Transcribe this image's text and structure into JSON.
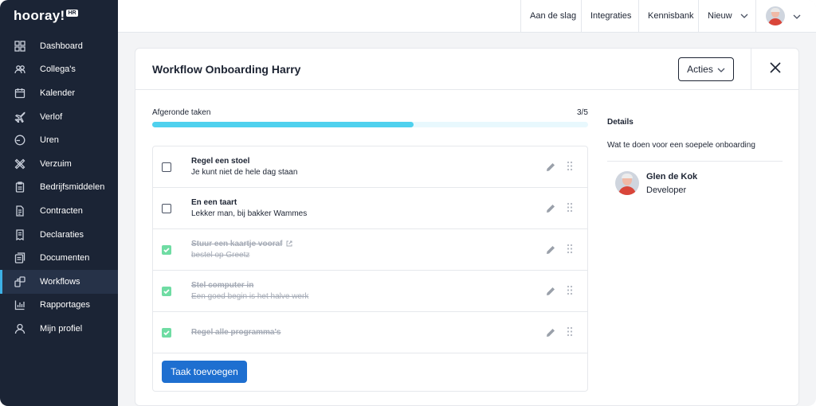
{
  "app": {
    "logo_text": "hooray!",
    "logo_badge": "HR"
  },
  "sidebar": {
    "items": [
      {
        "label": "Dashboard",
        "icon": "dashboard-icon"
      },
      {
        "label": "Collega's",
        "icon": "colleagues-icon"
      },
      {
        "label": "Kalender",
        "icon": "calendar-icon"
      },
      {
        "label": "Verlof",
        "icon": "plane-icon"
      },
      {
        "label": "Uren",
        "icon": "clock-icon"
      },
      {
        "label": "Verzuim",
        "icon": "bandage-icon"
      },
      {
        "label": "Bedrijfsmiddelen",
        "icon": "clipboard-icon"
      },
      {
        "label": "Contracten",
        "icon": "contract-icon"
      },
      {
        "label": "Declaraties",
        "icon": "receipt-icon"
      },
      {
        "label": "Documenten",
        "icon": "documents-icon"
      },
      {
        "label": "Workflows",
        "icon": "workflow-icon",
        "active": true
      },
      {
        "label": "Rapportages",
        "icon": "chart-icon"
      },
      {
        "label": "Mijn profiel",
        "icon": "user-icon"
      }
    ]
  },
  "topbar": {
    "items": [
      "Aan de slag",
      "Integraties",
      "Kennisbank",
      "Nieuw"
    ]
  },
  "panel": {
    "title": "Workflow Onboarding Harry",
    "actions_label": "Acties",
    "progress_label": "Afgeronde taken",
    "progress_count": "3/5",
    "progress_fraction": 0.6,
    "tasks": [
      {
        "title": "Regel een stoel",
        "sub": "Je kunt niet de hele dag staan",
        "done": false
      },
      {
        "title": "En een taart",
        "sub": "Lekker man, bij bakker Wammes",
        "done": false
      },
      {
        "title": "Stuur een kaartje vooraf",
        "sub": "bestel op Greetz",
        "done": true,
        "external": true
      },
      {
        "title": "Stel computer in",
        "sub": "Een goed begin is het halve werk",
        "done": true
      },
      {
        "title": "Regel alle programma's",
        "sub": "",
        "done": true
      }
    ],
    "add_task_label": "Taak toevoegen"
  },
  "details": {
    "title": "Details",
    "description": "Wat te doen voor een soepele onboarding",
    "person_name": "Glen de Kok",
    "person_role": "Developer"
  },
  "colors": {
    "sidebar_bg": "#1b2435",
    "accent": "#3db1e6",
    "progress": "#4fd1ee",
    "check": "#6fdca3",
    "primary_button": "#1e6fd0"
  }
}
